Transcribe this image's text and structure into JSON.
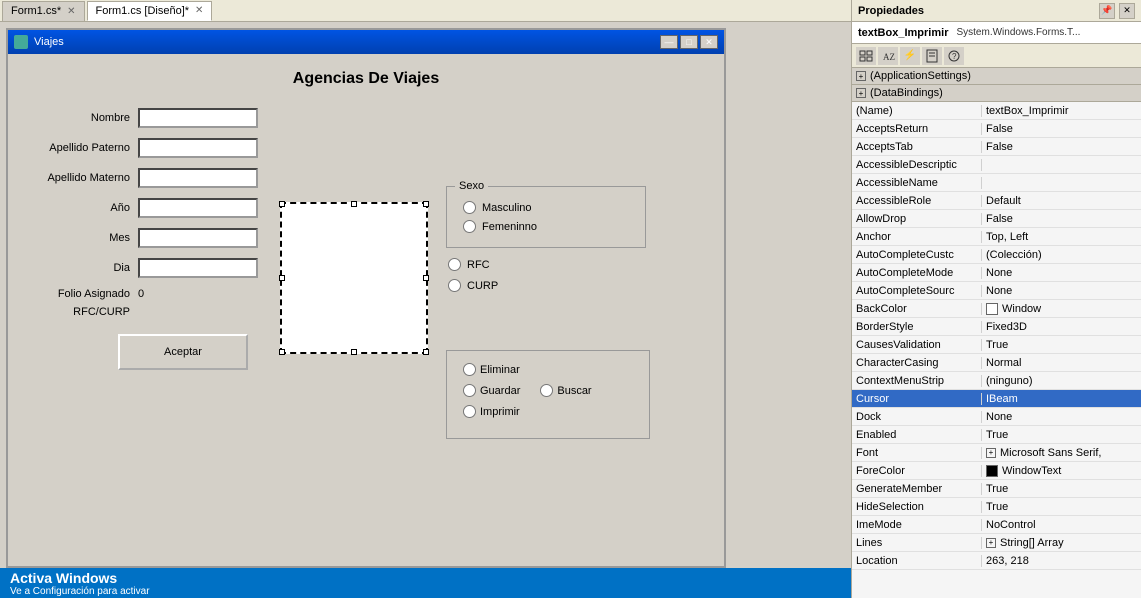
{
  "tabs": [
    {
      "id": "form1cs",
      "label": "Form1.cs*",
      "active": false,
      "closeable": true
    },
    {
      "id": "form1design",
      "label": "Form1.cs [Diseño]*",
      "active": true,
      "closeable": true
    }
  ],
  "form": {
    "title": "Viajes",
    "heading": "Agencias De Viajes",
    "controls": {
      "minimize": "—",
      "maximize": "□",
      "close": "✕"
    },
    "fields": [
      {
        "label": "Nombre",
        "id": "nombre"
      },
      {
        "label": "Apellido Paterno",
        "id": "apellido_paterno"
      },
      {
        "label": "Apellido Materno",
        "id": "apellido_materno"
      },
      {
        "label": "Año",
        "id": "anio"
      },
      {
        "label": "Mes",
        "id": "mes"
      },
      {
        "label": "Dia",
        "id": "dia"
      }
    ],
    "folio": {
      "label": "Folio Asignado",
      "value": "0"
    },
    "rfc_curp": {
      "label": "RFC/CURP"
    },
    "accept_btn": "Aceptar",
    "sexo": {
      "title": "Sexo",
      "options": [
        "Masculino",
        "Femeninno"
      ]
    },
    "rfc_options": [
      "RFC",
      "CURP"
    ],
    "action_options": [
      "Eliminar",
      "Guardar",
      "Buscar",
      "Imprimir"
    ]
  },
  "properties": {
    "title": "Propiedades",
    "target_name": "textBox_Imprimir",
    "target_type": "System.Windows.Forms.T...",
    "toolbar_icons": [
      "grid-icon",
      "sort-icon",
      "event-icon",
      "property-icon",
      "page-icon"
    ],
    "sections": [
      {
        "name": "ApplicationSettings",
        "expanded": true,
        "rows": []
      },
      {
        "name": "DataBindings",
        "expanded": true,
        "rows": []
      }
    ],
    "rows": [
      {
        "key": "(Name)",
        "value": "textBox_Imprimir",
        "highlight": false,
        "type": "text"
      },
      {
        "key": "AcceptsReturn",
        "value": "False",
        "highlight": false,
        "type": "text"
      },
      {
        "key": "AcceptsTab",
        "value": "False",
        "highlight": false,
        "type": "text"
      },
      {
        "key": "AccessibleDescriptic",
        "value": "",
        "highlight": false,
        "type": "text"
      },
      {
        "key": "AccessibleName",
        "value": "",
        "highlight": false,
        "type": "text"
      },
      {
        "key": "AccessibleRole",
        "value": "Default",
        "highlight": false,
        "type": "text"
      },
      {
        "key": "AllowDrop",
        "value": "False",
        "highlight": false,
        "type": "text"
      },
      {
        "key": "Anchor",
        "value": "Top, Left",
        "highlight": false,
        "type": "text"
      },
      {
        "key": "AutoCompleteCustc",
        "value": "(Colección)",
        "highlight": false,
        "type": "text"
      },
      {
        "key": "AutoCompleteMode",
        "value": "None",
        "highlight": false,
        "type": "text"
      },
      {
        "key": "AutoCompleteSourc",
        "value": "None",
        "highlight": false,
        "type": "text"
      },
      {
        "key": "BackColor",
        "value": "Window",
        "highlight": false,
        "type": "color",
        "color": "#ffffff"
      },
      {
        "key": "BorderStyle",
        "value": "Fixed3D",
        "highlight": false,
        "type": "text"
      },
      {
        "key": "CausesValidation",
        "value": "True",
        "highlight": false,
        "type": "text"
      },
      {
        "key": "CharacterCasing",
        "value": "Normal",
        "highlight": false,
        "type": "text"
      },
      {
        "key": "ContextMenuStrip",
        "value": "(ninguno)",
        "highlight": false,
        "type": "text"
      },
      {
        "key": "Cursor",
        "value": "IBeam",
        "highlight": true,
        "type": "text"
      },
      {
        "key": "Dock",
        "value": "None",
        "highlight": false,
        "type": "text"
      },
      {
        "key": "Enabled",
        "value": "True",
        "highlight": false,
        "type": "text"
      },
      {
        "key": "Font",
        "value": "Microsoft Sans Serif,",
        "highlight": false,
        "type": "expandable"
      },
      {
        "key": "ForeColor",
        "value": "WindowText",
        "highlight": false,
        "type": "color",
        "color": "#000000"
      },
      {
        "key": "GenerateMember",
        "value": "True",
        "highlight": false,
        "type": "text"
      },
      {
        "key": "HideSelection",
        "value": "True",
        "highlight": false,
        "type": "text"
      },
      {
        "key": "ImeMode",
        "value": "NoControl",
        "highlight": false,
        "type": "text"
      },
      {
        "key": "Lines",
        "value": "String[] Array",
        "highlight": false,
        "type": "expandable"
      },
      {
        "key": "Location",
        "value": "263, 218",
        "highlight": false,
        "type": "text"
      }
    ]
  },
  "status": {
    "activate_text": "Activa Windows",
    "sub_text": "Ve a Configuración para activar"
  }
}
